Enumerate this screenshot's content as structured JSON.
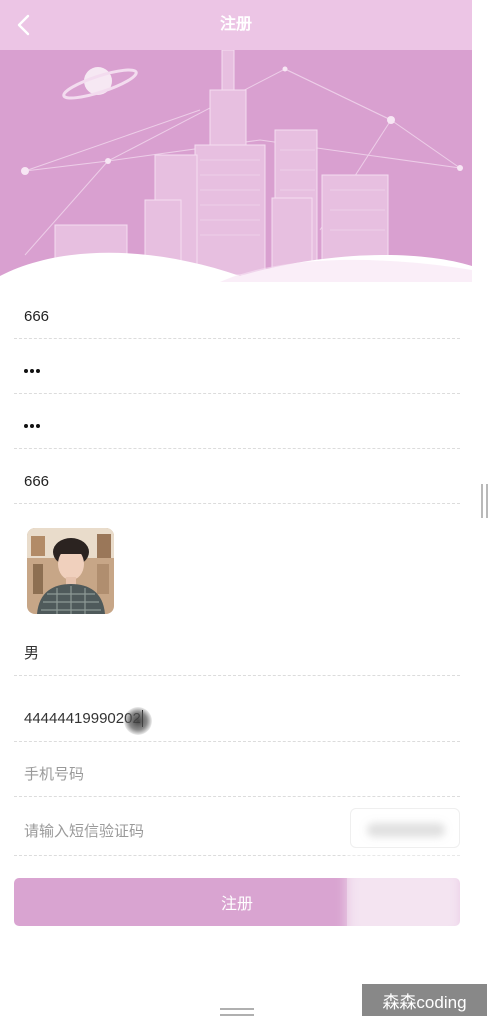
{
  "header": {
    "title": "注册",
    "back_icon": "chevron-left-icon",
    "background_color": "#ecc5e5"
  },
  "banner": {
    "background_color": "#d9a0d0"
  },
  "form": {
    "username": {
      "value": "666"
    },
    "password": {
      "masked_length": 3
    },
    "confirm_password": {
      "masked_length": 3
    },
    "nickname": {
      "value": "666"
    },
    "gender": {
      "value": "男"
    },
    "id_number": {
      "value": "44444419990202"
    },
    "phone": {
      "placeholder": "手机号码"
    },
    "sms_code": {
      "placeholder": "请输入短信验证码"
    }
  },
  "submit_button": {
    "label": "注册",
    "color": "#d9a4d1"
  },
  "watermark": {
    "text": "森森coding"
  }
}
